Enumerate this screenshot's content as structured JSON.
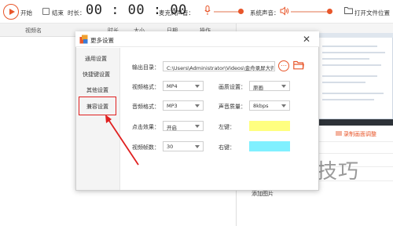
{
  "toolbar": {
    "start_label": "开始",
    "stop_label": "结束",
    "duration_label": "时长：",
    "timer": "00 : 00 : 00",
    "mic_label": "麦克风声音：",
    "system_label": "系统声音：",
    "open_folder_label": "打开文件位置"
  },
  "table_header": {
    "col_name": "视频名",
    "col_duration": "时长",
    "col_size": "大小",
    "col_date": "日期",
    "col_action": "操作"
  },
  "side_panel": {
    "record_link": "录制画面调整",
    "add_picture": "添加图片",
    "watermark": "软件技巧"
  },
  "dialog": {
    "title": "更多设置",
    "close": "✕",
    "sidebar": [
      "通用设置",
      "快捷键设置",
      "其他设置",
      "兼容设置"
    ],
    "output_dir_label": "输出目录：",
    "output_dir_value": "C:\\Users\\Administrator\\Videos\\金舟录屏大师",
    "video_format_label": "视频格式：",
    "video_format_value": "MP4",
    "quality_label": "画质设置：",
    "quality_value": "原画",
    "audio_format_label": "音频格式：",
    "audio_format_value": "MP3",
    "audio_quality_label": "声音质量：",
    "audio_quality_value": "8kbps",
    "click_effect_label": "点击效果：",
    "click_effect_value": "开启",
    "left_key_label": "左键：",
    "left_key_color": "#ffff80",
    "fps_label": "视频帧数：",
    "fps_value": "30",
    "right_key_label": "右键：",
    "right_key_color": "#80f0ff",
    "more_button": "⋯"
  },
  "colors": {
    "accent": "#e8562a",
    "highlight": "#e02020"
  }
}
